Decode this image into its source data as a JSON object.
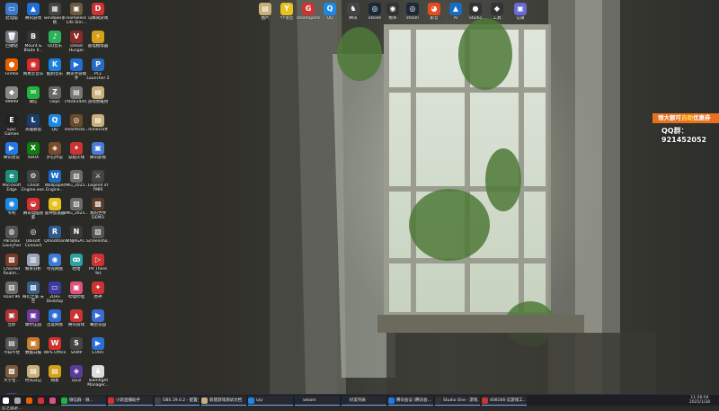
{
  "desktop_icons_left": [
    {
      "label": "此电脑",
      "color": "#3a78c9",
      "glyph": "▭"
    },
    {
      "label": "腾讯游戏",
      "color": "#1d6fd6",
      "glyph": "▲"
    },
    {
      "label": "windows系统",
      "color": "#444",
      "glyph": "▦"
    },
    {
      "label": "Homeless Life Sim...",
      "color": "#6d5a43",
      "glyph": "▣"
    },
    {
      "label": "马蜂窝游戏",
      "color": "#c33",
      "glyph": "D"
    },
    {
      "label": "回收站",
      "color": "#6f7680",
      "glyph": "🗑"
    },
    {
      "label": "Mount & Blade II...",
      "color": "#333",
      "glyph": "B"
    },
    {
      "label": "QQ音乐",
      "color": "#2fb05b",
      "glyph": "♪"
    },
    {
      "label": "Dread Hunger",
      "color": "#8a2b2b",
      "glyph": "V"
    },
    {
      "label": "雷电模拟器",
      "color": "#d4a017",
      "glyph": "⚡"
    },
    {
      "label": "Firefox",
      "color": "#e66000",
      "glyph": "●"
    },
    {
      "label": "网易云音乐",
      "color": "#d72b2b",
      "glyph": "◉"
    },
    {
      "label": "酷狗音乐",
      "color": "#1b7fe0",
      "glyph": "K"
    },
    {
      "label": "腾讯手游助手",
      "color": "#1d6fd6",
      "glyph": "▶"
    },
    {
      "label": "PCL Launcher 2",
      "color": "#2a6cc2",
      "glyph": "P"
    },
    {
      "label": "99999",
      "color": "#888",
      "glyph": "◆"
    },
    {
      "label": "微信",
      "color": "#24b13d",
      "glyph": "✉"
    },
    {
      "label": "Oops",
      "color": "#666",
      "glyph": "Z"
    },
    {
      "label": "cf4d034d4...",
      "color": "#777",
      "glyph": "▤"
    },
    {
      "label": "游戏暂缓用",
      "color": "#c9b079",
      "glyph": "▤"
    },
    {
      "label": "Epic Games Launcher",
      "color": "#222",
      "glyph": "E"
    },
    {
      "label": "英雄联盟",
      "color": "#1a3d6b",
      "glyph": "L"
    },
    {
      "label": "QQ",
      "color": "#1d87e4",
      "glyph": "Q"
    },
    {
      "label": "Hearthsto...",
      "color": "#6b4a2a",
      "glyph": "◎"
    },
    {
      "label": "minecraft",
      "color": "#c9b079",
      "glyph": "▤"
    },
    {
      "label": "腾讯会议",
      "color": "#2577e3",
      "glyph": "▶"
    },
    {
      "label": "XBOX",
      "color": "#107c10",
      "glyph": "X"
    },
    {
      "label": "炉石传说",
      "color": "#7b4a2a",
      "glyph": "◈"
    },
    {
      "label": "穿越火线",
      "color": "#c33",
      "glyph": "✦"
    },
    {
      "label": "腾讯影视",
      "color": "#4a7bd4",
      "glyph": "▣"
    },
    {
      "label": "Microsoft Edge",
      "color": "#1b8e7e",
      "glyph": "e"
    },
    {
      "label": "Cheat Engine.exe...",
      "color": "#444",
      "glyph": "⚙"
    },
    {
      "label": "Wallpaper Engine...",
      "color": "#1a6bc2",
      "glyph": "W"
    },
    {
      "label": "IMG_2025...",
      "color": "#6b6b6b",
      "glyph": "▨"
    },
    {
      "label": "Legend of YMIR",
      "color": "#444",
      "glyph": "⚔"
    },
    {
      "label": "专利",
      "color": "#1d87e4",
      "glyph": "◉"
    },
    {
      "label": "腾讯电脑管家",
      "color": "#d73030",
      "glyph": "◒"
    },
    {
      "label": "雷神加速器",
      "color": "#e8c020",
      "glyph": "⊕"
    },
    {
      "label": "IMG_2025...",
      "color": "#6b6b6b",
      "glyph": "▨"
    },
    {
      "label": "我的世界DEMO",
      "color": "#5b3d2a",
      "glyph": "▩"
    },
    {
      "label": "Paradox Launcher v2",
      "color": "#555",
      "glyph": "◍"
    },
    {
      "label": "Ubisoft Connect",
      "color": "#2b2b2b",
      "glyph": "◎"
    },
    {
      "label": "Qmodman",
      "color": "#2d5b8c",
      "glyph": "R"
    },
    {
      "label": "NINJAGAI...",
      "color": "#3a3a3a",
      "glyph": "N"
    },
    {
      "label": "Screensho...",
      "color": "#555",
      "glyph": "▧"
    },
    {
      "label": "Charred Realm...",
      "color": "#7a3b2b",
      "glyph": "▩"
    },
    {
      "label": "帧率分析",
      "color": "#9aa4b8",
      "glyph": "▥"
    },
    {
      "label": "夸克网盘",
      "color": "#3a7bd5",
      "glyph": "◉"
    },
    {
      "label": "哈哈",
      "color": "#2fa0a0",
      "glyph": "ꝏ"
    },
    {
      "label": "PV There Yet",
      "color": "#c33",
      "glyph": "▷"
    },
    {
      "label": "Road 96",
      "color": "#6b6b6b",
      "glyph": "▨"
    },
    {
      "label": "奇幻之旅 天空",
      "color": "#3a5f8a",
      "glyph": "▩"
    },
    {
      "label": "2Dev Desktop",
      "color": "#3a3aa0",
      "glyph": "▭"
    },
    {
      "label": "哔哩哔哩",
      "color": "#e0527a",
      "glyph": "▣"
    },
    {
      "label": "原神",
      "color": "#c33",
      "glyph": "✦"
    },
    {
      "label": "立即",
      "color": "#a33",
      "glyph": "▣"
    },
    {
      "label": "摩尔庄园",
      "color": "#6a3aa0",
      "glyph": "▣"
    },
    {
      "label": "百度网盘",
      "color": "#2b6fd6",
      "glyph": "◉"
    },
    {
      "label": "腾讯游戏",
      "color": "#c33",
      "glyph": "▲"
    },
    {
      "label": "幕后花园",
      "color": "#3a6bd4",
      "glyph": "▶"
    },
    {
      "label": "不知不觉",
      "color": "#555",
      "glyph": "▤"
    },
    {
      "label": "数据日报",
      "color": "#c97b2b",
      "glyph": "▣"
    },
    {
      "label": "WPS Office",
      "color": "#d32f2f",
      "glyph": "W"
    },
    {
      "label": "SAMP",
      "color": "#444",
      "glyph": "S"
    },
    {
      "label": "START",
      "color": "#2b6fd6",
      "glyph": "▶"
    },
    {
      "label": "大学生...",
      "color": "#7a5b3b",
      "glyph": "▩"
    },
    {
      "label": "时光日记",
      "color": "#c9b079",
      "glyph": "▤"
    },
    {
      "label": "网易",
      "color": "#d4a017",
      "glyph": "▤"
    },
    {
      "label": "cpuz",
      "color": "#5a3a9a",
      "glyph": "◈"
    },
    {
      "label": "Teamfight Manager...",
      "color": "#ddd",
      "glyph": "♟"
    },
    {
      "label": "云之旅游...",
      "color": "#5b3d8a",
      "glyph": "▩"
    }
  ],
  "desktop_icons_top": [
    {
      "label": "图片",
      "color": "#c9b079",
      "glyph": "▤"
    },
    {
      "label": "YY语音",
      "color": "#e8c020",
      "glyph": "Y"
    },
    {
      "label": "steamgame",
      "color": "#c33",
      "glyph": "G"
    },
    {
      "label": "QQ",
      "color": "#1d87e4",
      "glyph": "Q"
    },
    {
      "label": "腾讯",
      "color": "#444",
      "glyph": "♞"
    },
    {
      "label": "Steam",
      "color": "#1b2838",
      "glyph": "◎"
    },
    {
      "label": "帧率",
      "color": "#333",
      "glyph": "◉"
    },
    {
      "label": "steam",
      "color": "#1b2838",
      "glyph": "◎"
    },
    {
      "label": "影音",
      "color": "#e84c1c",
      "glyph": "◕"
    },
    {
      "label": "AI",
      "color": "#1a6bc2",
      "glyph": "▲"
    },
    {
      "label": "Studio",
      "color": "#333",
      "glyph": "●"
    },
    {
      "label": "工具",
      "color": "#333",
      "glyph": "◆"
    },
    {
      "label": "记录",
      "color": "#6a6ad4",
      "glyph": "▣"
    }
  ],
  "promo": {
    "title_pre": "领大额可",
    "title_highlight": "自助",
    "title_post": "优惠券",
    "qq_text": "QQ群：921452052"
  },
  "taskbar": {
    "items": [
      {
        "label": "",
        "color": "#ffffff",
        "active": false,
        "kind": "start"
      },
      {
        "label": "",
        "color": "#aaa",
        "active": false,
        "kind": "search"
      },
      {
        "label": "",
        "color": "#e66000",
        "active": false,
        "kind": "app"
      },
      {
        "label": "",
        "color": "#d73030",
        "active": false,
        "kind": "app"
      },
      {
        "label": "",
        "color": "#e0527a",
        "active": false,
        "kind": "app"
      },
      {
        "label": "微信群 - 微...",
        "color": "#24b13d",
        "active": true,
        "kind": "app"
      },
      {
        "label": "小新直播助手",
        "color": "#d73030",
        "active": true,
        "kind": "app"
      },
      {
        "label": "OBS 29.0.2 - 配置文...",
        "color": "#444",
        "active": true,
        "kind": "app"
      },
      {
        "label": "新建游戏测试文档",
        "color": "#c9b079",
        "active": true,
        "kind": "app"
      },
      {
        "label": "QQ",
        "color": "#1d87e4",
        "active": true,
        "kind": "app"
      },
      {
        "label": "Steam",
        "color": "#1b2838",
        "active": true,
        "kind": "app"
      },
      {
        "label": "好友列表",
        "color": "#1b2838",
        "active": true,
        "kind": "app"
      },
      {
        "label": "腾讯会议 (腾讯会...",
        "color": "#2577e3",
        "active": true,
        "kind": "app"
      },
      {
        "label": "Studio One - 游戏...",
        "color": "#333",
        "active": true,
        "kind": "app"
      },
      {
        "label": "408166-云游戏工...",
        "color": "#c33",
        "active": true,
        "kind": "app"
      }
    ],
    "clock_time": "11:26:04",
    "clock_date": "2025/1/28"
  }
}
